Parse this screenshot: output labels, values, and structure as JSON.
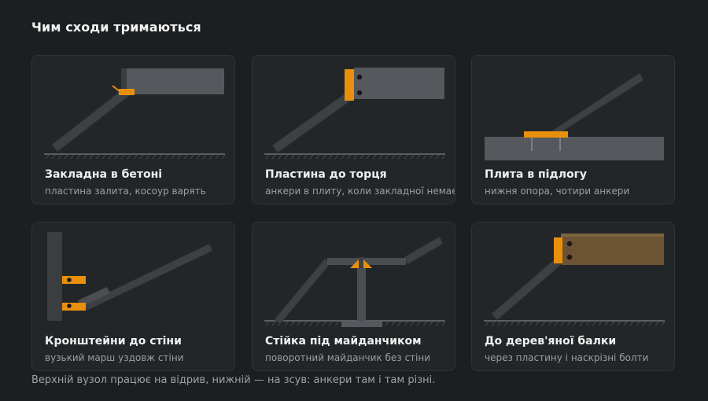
{
  "title": "Чим сходи тримаються",
  "cards": [
    {
      "title": "Закладна в бетоні",
      "subtitle": "пластина залита, косоур варять"
    },
    {
      "title": "Пластина до торця",
      "subtitle": "анкери в плиту, коли закладної немає"
    },
    {
      "title": "Плита в підлогу",
      "subtitle": "нижня опора, чотири анкери"
    },
    {
      "title": "Кронштейни до стіни",
      "subtitle": "вузький марш уздовж стіни"
    },
    {
      "title": "Стійка під майданчиком",
      "subtitle": "поворотний майданчик без стіни"
    },
    {
      "title": "До дерев'яної балки",
      "subtitle": "через пластину і наскрізні болти"
    }
  ],
  "footnote": "Верхній вузол працює на відрив, нижній — на зсув: анкери там і там різні.",
  "colors": {
    "background": "#1c1f21",
    "card": "#232628",
    "stringer": "#3d4144",
    "slab": "#55595d",
    "accent": "#e8900c",
    "wood": "#6b5333"
  }
}
